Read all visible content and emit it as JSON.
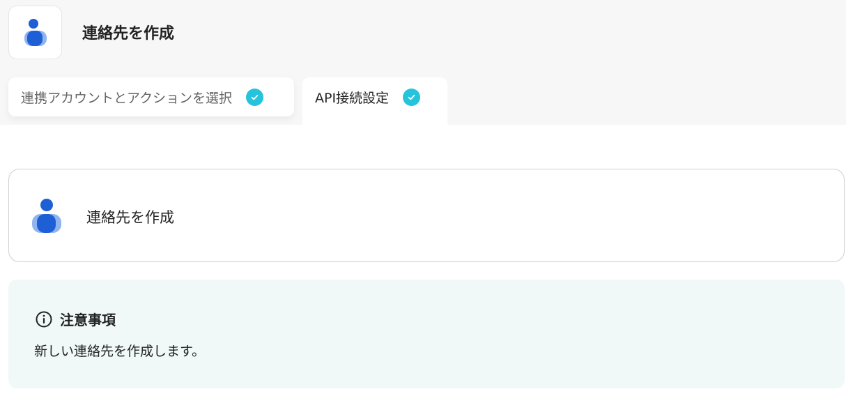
{
  "header": {
    "title": "連絡先を作成",
    "icon": "person-icon"
  },
  "tabs": [
    {
      "label": "連携アカウントとアクションを選択",
      "completed": true
    },
    {
      "label": "API接続設定",
      "completed": true
    }
  ],
  "action": {
    "label": "連絡先を作成",
    "icon": "person-icon"
  },
  "notice": {
    "title": "注意事項",
    "body": "新しい連絡先を作成します。",
    "icon": "info-icon"
  },
  "colors": {
    "check": "#25c3dc",
    "icon_dark": "#1f5fd6",
    "icon_light": "#8fb4f0",
    "notice_bg": "#f0f9f8"
  }
}
